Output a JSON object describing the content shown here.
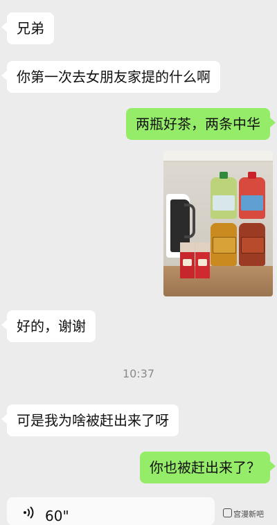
{
  "chat": {
    "messages": [
      {
        "side": "left",
        "text": "兄弟"
      },
      {
        "side": "left",
        "text": "你第一次去女朋友家提的什么啊"
      },
      {
        "side": "right",
        "text": "两瓶好茶，两条中华"
      },
      {
        "side": "right",
        "image": "photo of two tea bottles and two cartons of cigarettes on a shelf"
      },
      {
        "side": "left",
        "text": "好的，谢谢"
      },
      {
        "side": "left",
        "text": "可是我为啥被赶出来了呀"
      },
      {
        "side": "right",
        "text": "你也被赶出来了？"
      }
    ],
    "timestamp": "10:37",
    "voice_message": {
      "duration": "60\""
    }
  },
  "watermark": {
    "text": "宫漫新吧"
  },
  "colors": {
    "background": "#ececec",
    "incoming_bubble": "#ffffff",
    "outgoing_bubble": "#95ec69",
    "timestamp_text": "#8a8a8a"
  },
  "icons": {
    "voice": "voice-wave-icon",
    "watermark": "watermark-logo-icon"
  }
}
